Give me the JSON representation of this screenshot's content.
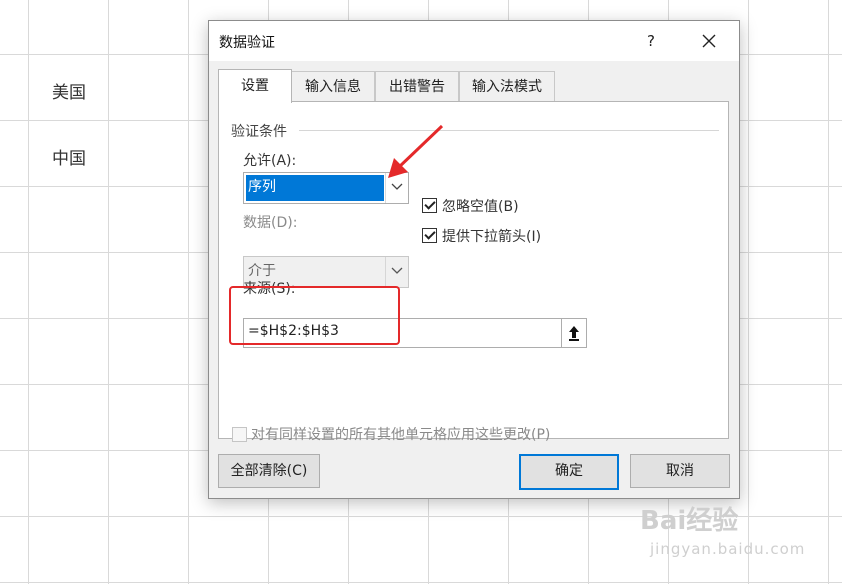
{
  "sheet": {
    "cells": [
      "美国",
      "中国"
    ]
  },
  "dialog": {
    "title": "数据验证",
    "help_label": "?",
    "close_label": "✕",
    "tabs": [
      {
        "label": "设置",
        "active": true
      },
      {
        "label": "输入信息",
        "active": false
      },
      {
        "label": "出错警告",
        "active": false
      },
      {
        "label": "输入法模式",
        "active": false
      }
    ],
    "section_title": "验证条件",
    "allow_label": "允许(A):",
    "allow_value": "序列",
    "data_label": "数据(D):",
    "data_value": "介于",
    "ignore_blank_label": "忽略空值(B)",
    "ignore_blank_checked": true,
    "dropdown_arrow_label": "提供下拉箭头(I)",
    "dropdown_arrow_checked": true,
    "source_label": "来源(S):",
    "source_value": "=$H$2:$H$3",
    "apply_all_label": "对有同样设置的所有其他单元格应用这些更改(P)",
    "apply_all_checked": false,
    "clear_all_label": "全部清除(C)",
    "ok_label": "确定",
    "cancel_label": "取消"
  },
  "watermark": {
    "brand": "Bai经验",
    "url": "jingyan.baidu.com"
  },
  "colors": {
    "selection": "#0078d7",
    "annotation": "#e4292a"
  }
}
